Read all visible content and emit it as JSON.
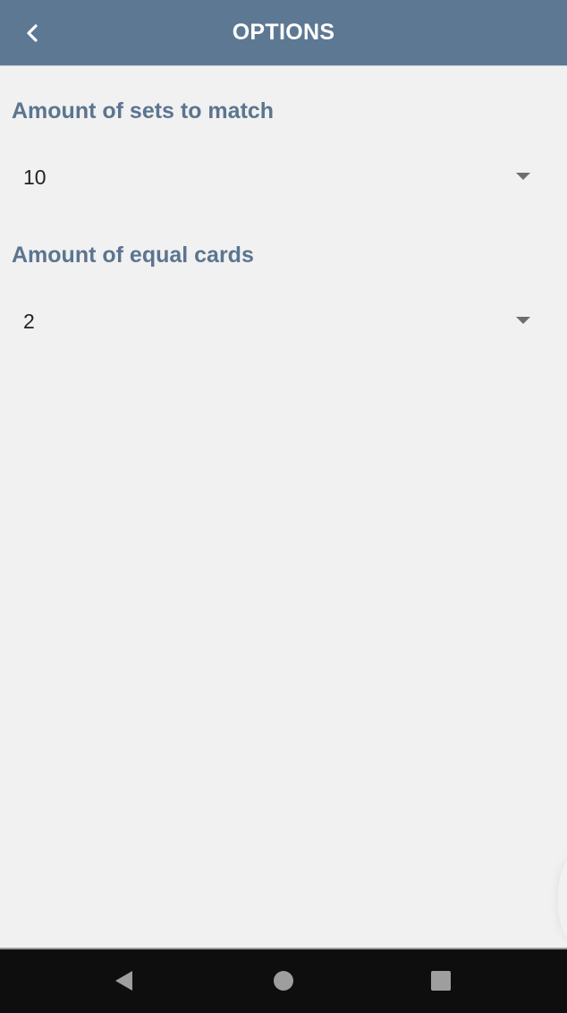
{
  "header": {
    "title": "OPTIONS",
    "back_icon": "chevron-left-icon"
  },
  "colors": {
    "accent": "#5d7893",
    "label": "#5b7590",
    "nav_bar": "#0e0e0e"
  },
  "options": [
    {
      "label": "Amount of sets to match",
      "value": "10"
    },
    {
      "label": "Amount of equal cards",
      "value": "2"
    }
  ],
  "nav": {
    "back": "nav-back-icon",
    "home": "nav-home-icon",
    "recents": "nav-recents-icon"
  }
}
